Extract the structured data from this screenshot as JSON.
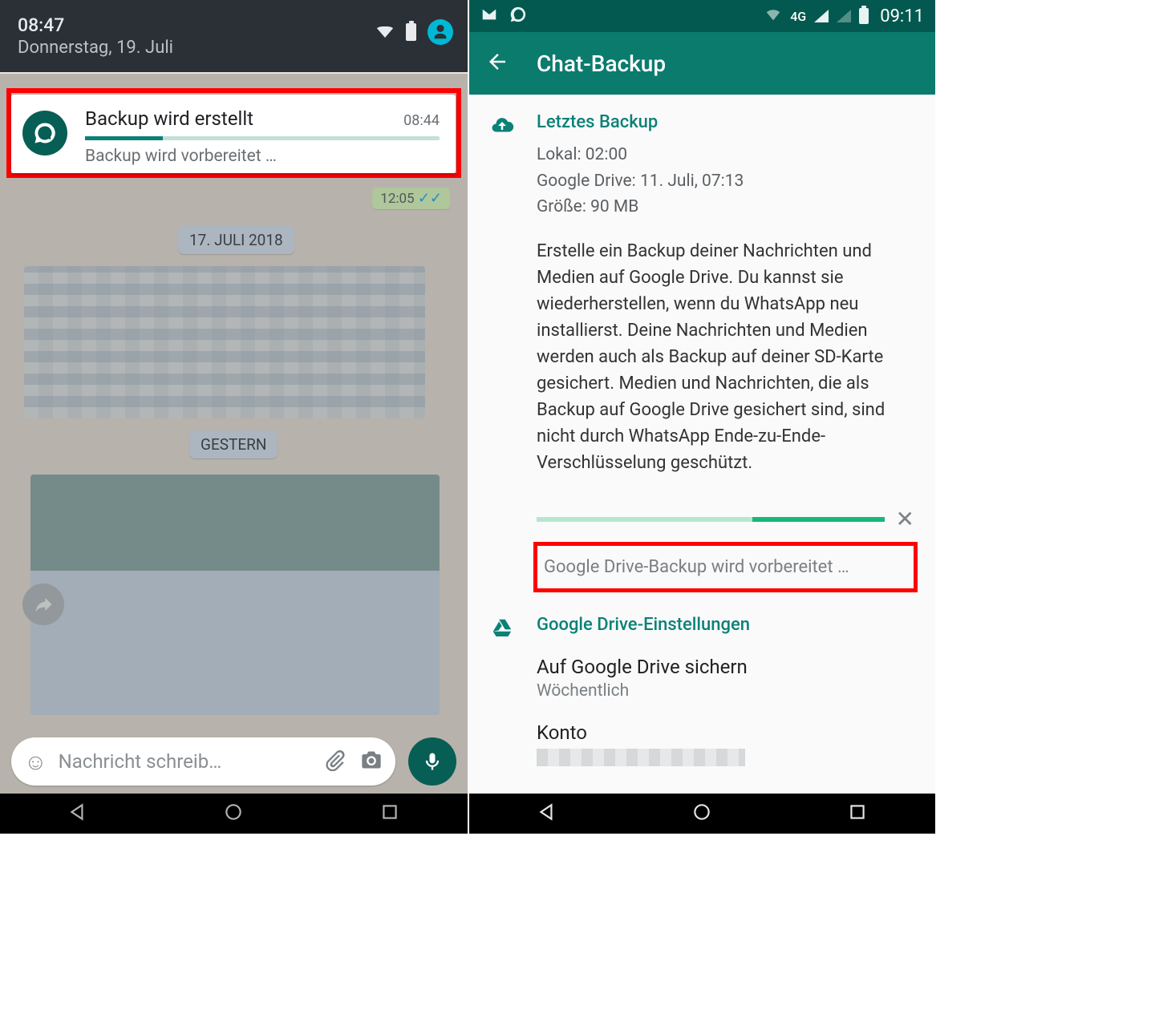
{
  "left": {
    "topbar_time": "08:47",
    "topbar_date": "Donnerstag, 19. Juli",
    "notification": {
      "title": "Backup wird erstellt",
      "time": "08:44",
      "subtitle": "Backup wird vorbereitet …"
    },
    "prev_msg_time": "12:05",
    "date_chip_1": "17. JULI 2018",
    "date_chip_2": "GESTERN",
    "input_placeholder": "Nachricht schreib…"
  },
  "right": {
    "status_time": "09:11",
    "status_network": "4G",
    "appbar_title": "Chat-Backup",
    "last_backup": {
      "section_title": "Letztes Backup",
      "local": "Lokal: 02:00",
      "gdrive": "Google Drive: 11. Juli, 07:13",
      "size": "Größe: 90 MB",
      "description": "Erstelle ein Backup deiner Nachrichten und Medien auf Google Drive. Du kannst sie wiederherstellen, wenn du WhatsApp neu installierst. Deine Nachrichten und Medien werden auch als Backup auf deiner SD-Karte gesichert. Medien und Nachrichten, die als Backup auf Google Drive gesichert sind, sind nicht durch WhatsApp Ende-zu-Ende-Verschlüsselung geschützt."
    },
    "progress_status": "Google Drive-Backup wird vorbereitet …",
    "gdrive_settings": {
      "section_title": "Google Drive-Einstellungen",
      "backup_label": "Auf Google Drive sichern",
      "backup_value": "Wöchentlich",
      "account_label": "Konto"
    }
  }
}
